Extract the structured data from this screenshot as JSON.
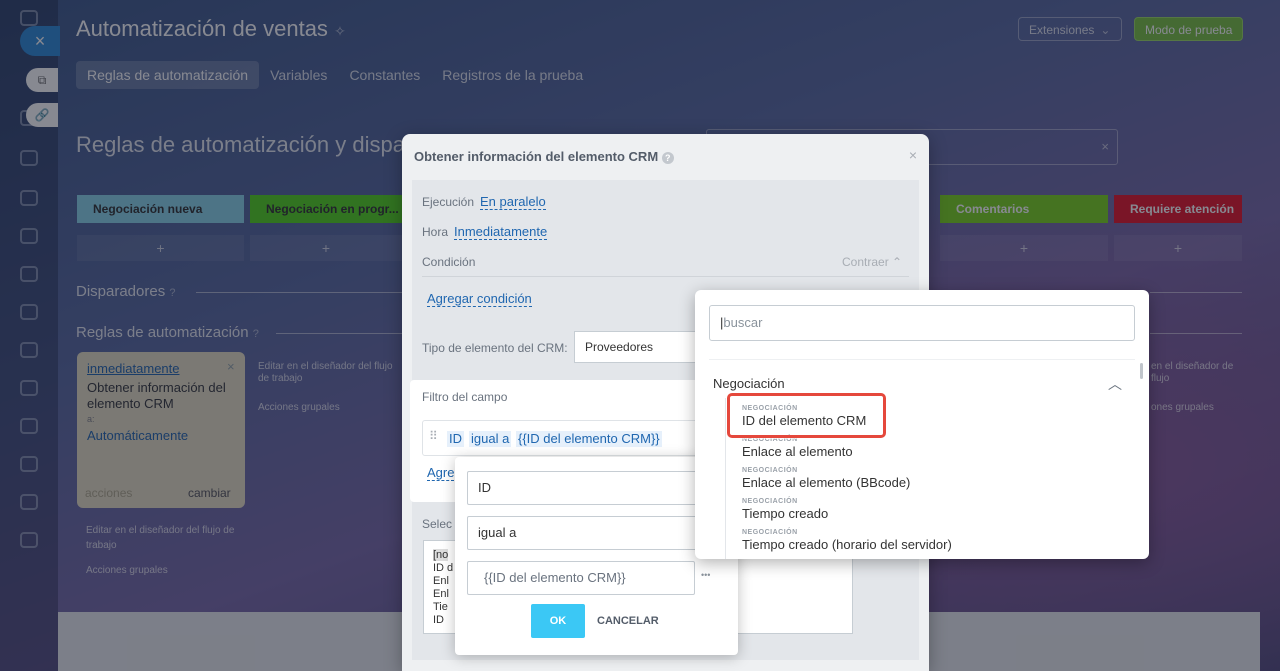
{
  "page": {
    "title": "Automatización de ventas",
    "pin_icon": "pin-icon",
    "ext_button": "Extensiones",
    "test_button": "Modo de prueba"
  },
  "tabs": [
    "Reglas de automatización",
    "Variables",
    "Constantes",
    "Registros de la prueba"
  ],
  "content": {
    "title": "Reglas de automatización y dispa",
    "stages": [
      {
        "label": "Negociación nueva",
        "color": "#8ad4e8"
      },
      {
        "label": "Negociación en progr...",
        "color": "#52d21e"
      },
      {
        "label": "Comentarios",
        "color": "#7ad21e"
      },
      {
        "label": "Requiere atención",
        "color": "#e5162a"
      }
    ],
    "plus": "+",
    "triggers_label": "Disparadores",
    "rules_label": "Reglas de automatización",
    "rule_card": {
      "when": "inmediatamente",
      "name": "Obtener información del elemento CRM",
      "to_label": "a:",
      "to_value": "Automáticamente",
      "actions_label": "acciones",
      "change_label": "cambiar"
    },
    "edit_designer": "Editar en el diseñador del flujo de trabajo",
    "group_actions": "Acciones grupales",
    "edit_designer_right": "en el diseñador de flujo",
    "group_actions_right": "ones grupales"
  },
  "modal": {
    "title": "Obtener información del elemento CRM",
    "exec_label": "Ejecución",
    "exec_value": "En paralelo",
    "time_label": "Hora",
    "time_value": "Inmediatamente",
    "cond_label": "Condición",
    "collapse": "Contraer",
    "add_cond": "Agregar condición",
    "type_label": "Tipo de elemento del CRM:",
    "type_value": "Proveedores",
    "filter_title": "Filtro del campo",
    "filter_field": "ID",
    "filter_op": "igual a",
    "filter_val": "{{ID del elemento CRM}}",
    "add_trunc": "Agre",
    "select_trunc": "Selec",
    "list_preview": [
      "[no",
      "ID d",
      "Enl",
      "Enl",
      "Tie",
      "ID"
    ]
  },
  "edit_popup": {
    "field": "ID",
    "operator": "igual a",
    "value_placeholder": "{{ID del elemento CRM}}",
    "more": "•••",
    "ok": "OK",
    "cancel": "CANCELAR"
  },
  "dropdown": {
    "placeholder": "buscar",
    "group": "Negociación",
    "items": [
      {
        "cat": "NEGOCIACIÓN",
        "label": "ID del elemento CRM"
      },
      {
        "cat": "NEGOCIACIÓN",
        "label": "Enlace al elemento"
      },
      {
        "cat": "NEGOCIACIÓN",
        "label": "Enlace al elemento (BBcode)"
      },
      {
        "cat": "NEGOCIACIÓN",
        "label": "Tiempo creado"
      },
      {
        "cat": "NEGOCIACIÓN",
        "label": "Tiempo creado (horario del servidor)"
      }
    ]
  }
}
